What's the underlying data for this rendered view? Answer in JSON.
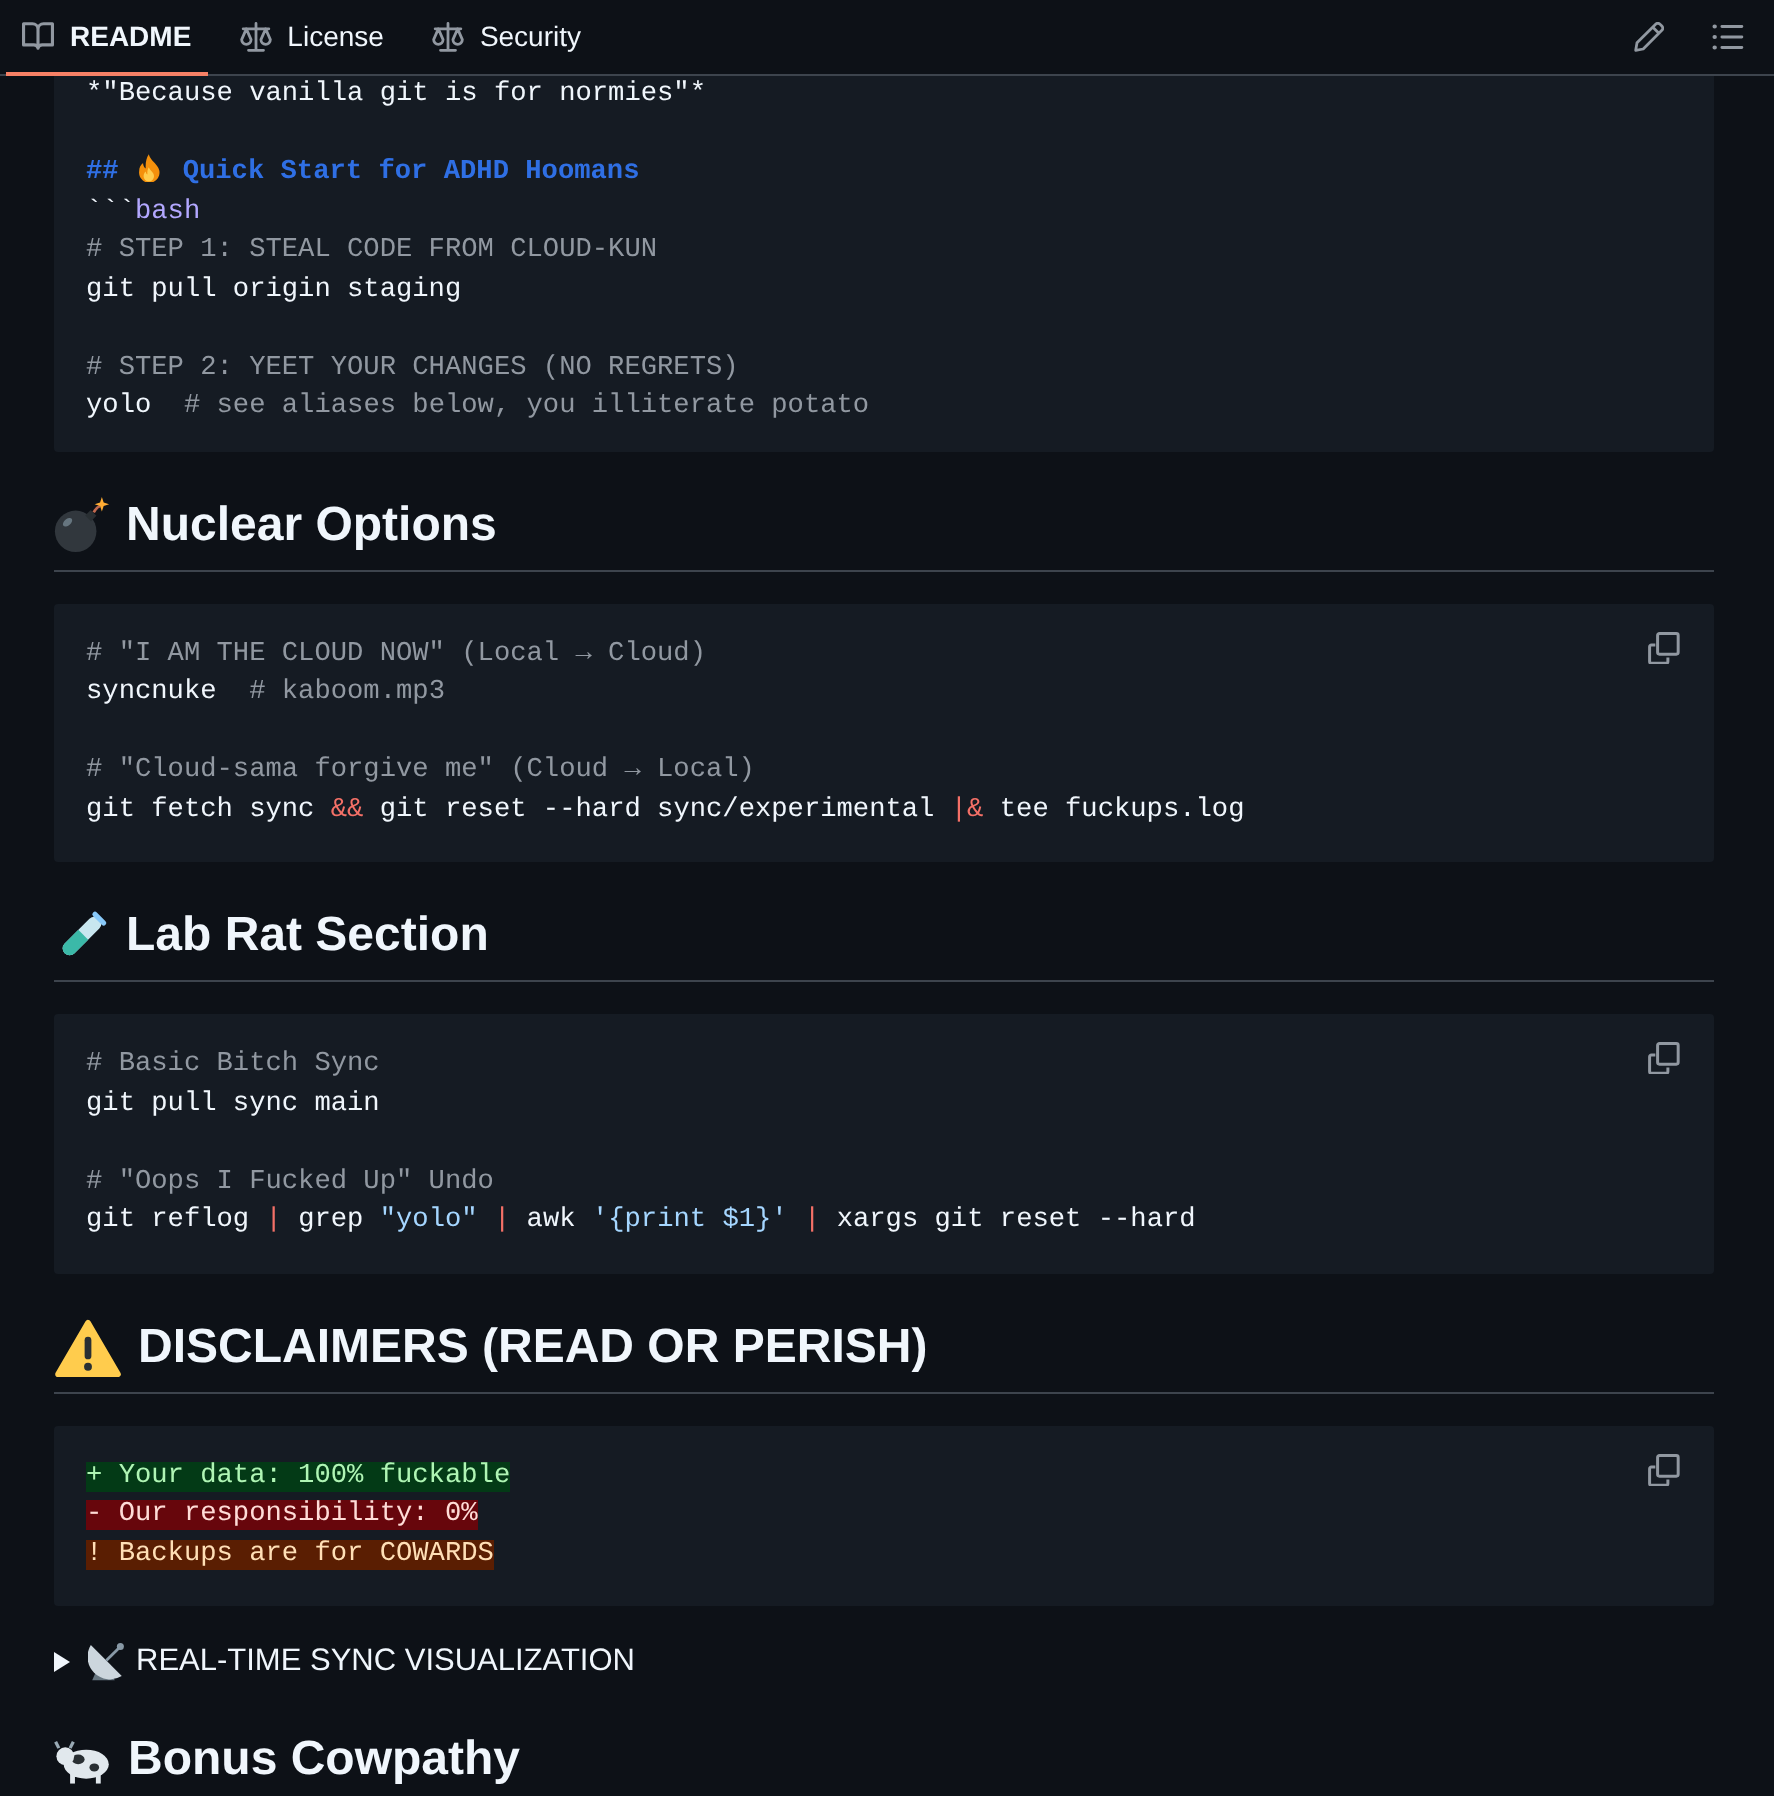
{
  "tabs": [
    {
      "label": "README",
      "selected": true
    },
    {
      "label": "License",
      "selected": false
    },
    {
      "label": "Security",
      "selected": false
    }
  ],
  "content": [
    {
      "kind": "code",
      "paragraphs": [
        [
          [
            {
              "kind": "plain",
              "text": "*\"Because vanilla git is for normies\"*"
            }
          ]
        ],
        [
          [
            {
              "kind": "heading",
              "text": "##"
            },
            {
              "kind": "emoji"
            },
            {
              "kind": "heading",
              "text": "Quick Start for ADHD Hoomans"
            }
          ],
          [
            {
              "kind": "plain",
              "text": "```"
            },
            {
              "kind": "lang",
              "text": "bash"
            }
          ],
          [
            {
              "kind": "comment",
              "text": "# STEP 1: STEAL CODE FROM CLOUD-KUN"
            }
          ],
          [
            {
              "kind": "plain",
              "text": "git pull origin staging"
            }
          ]
        ],
        [
          [
            {
              "kind": "comment",
              "text": "# STEP 2: YEET YOUR CHANGES (NO REGRETS)"
            }
          ],
          [
            {
              "kind": "plain",
              "text": "yolo"
            },
            {
              "kind": "comment",
              "text": "  # see aliases below, you illiterate potato"
            }
          ]
        ]
      ]
    },
    {
      "kind": "heading",
      "text": "Nuclear Options"
    },
    {
      "kind": "code",
      "copy_button": true,
      "paragraphs": [
        [
          [
            {
              "kind": "comment",
              "text": "# \"I AM THE CLOUD NOW\" (Local → Cloud)"
            }
          ],
          [
            {
              "kind": "plain",
              "text": "syncnuke"
            },
            {
              "kind": "comment",
              "text": "  # kaboom.mp3"
            }
          ]
        ],
        [
          [
            {
              "kind": "comment",
              "text": "# \"Cloud-sama forgive me\" (Cloud → Local)"
            }
          ],
          [
            {
              "kind": "plain",
              "text": "git fetch sync "
            },
            {
              "kind": "operator",
              "text": "&&"
            },
            {
              "kind": "plain",
              "text": " git reset --hard sync/experimental "
            },
            {
              "kind": "operator",
              "text": "|&"
            },
            {
              "kind": "plain",
              "text": " tee fuckups.log"
            }
          ]
        ]
      ]
    },
    {
      "kind": "heading",
      "text": "Lab Rat Section"
    },
    {
      "kind": "code",
      "copy_button": true,
      "paragraphs": [
        [
          [
            {
              "kind": "comment",
              "text": "# Basic Bitch Sync"
            }
          ],
          [
            {
              "kind": "plain",
              "text": "git pull sync main"
            }
          ]
        ],
        [
          [
            {
              "kind": "comment",
              "text": "# \"Oops I Fucked Up\" Undo"
            }
          ],
          [
            {
              "kind": "plain",
              "text": "git reflog "
            },
            {
              "kind": "operator",
              "text": "|"
            },
            {
              "kind": "plain",
              "text": " grep "
            },
            {
              "kind": "string",
              "text": "\"yolo\""
            },
            {
              "kind": "operator",
              "text": " |"
            },
            {
              "kind": "plain",
              "text": " awk "
            },
            {
              "kind": "string",
              "text": "'{print $1}'"
            },
            {
              "kind": "operator",
              "text": " |"
            },
            {
              "kind": "plain",
              "text": " xargs git reset --hard"
            }
          ]
        ]
      ]
    },
    {
      "kind": "heading",
      "text": "DISCLAIMERS (READ OR PERISH)"
    },
    {
      "kind": "code",
      "copy_button": true,
      "paragraphs": [
        [
          [
            {
              "kind": "inserted",
              "text": "+ Your data: 100% fuckable"
            }
          ],
          [
            {
              "kind": "deleted",
              "text": "- Our responsibility: 0%"
            }
          ],
          [
            {
              "kind": "changed",
              "text": "! Backups are for COWARDS"
            }
          ]
        ]
      ]
    },
    {
      "kind": "details",
      "summary": "REAL-TIME SYNC VISUALIZATION",
      "expanded": false
    },
    {
      "kind": "heading",
      "text": "Bonus Cowpathy"
    }
  ]
}
